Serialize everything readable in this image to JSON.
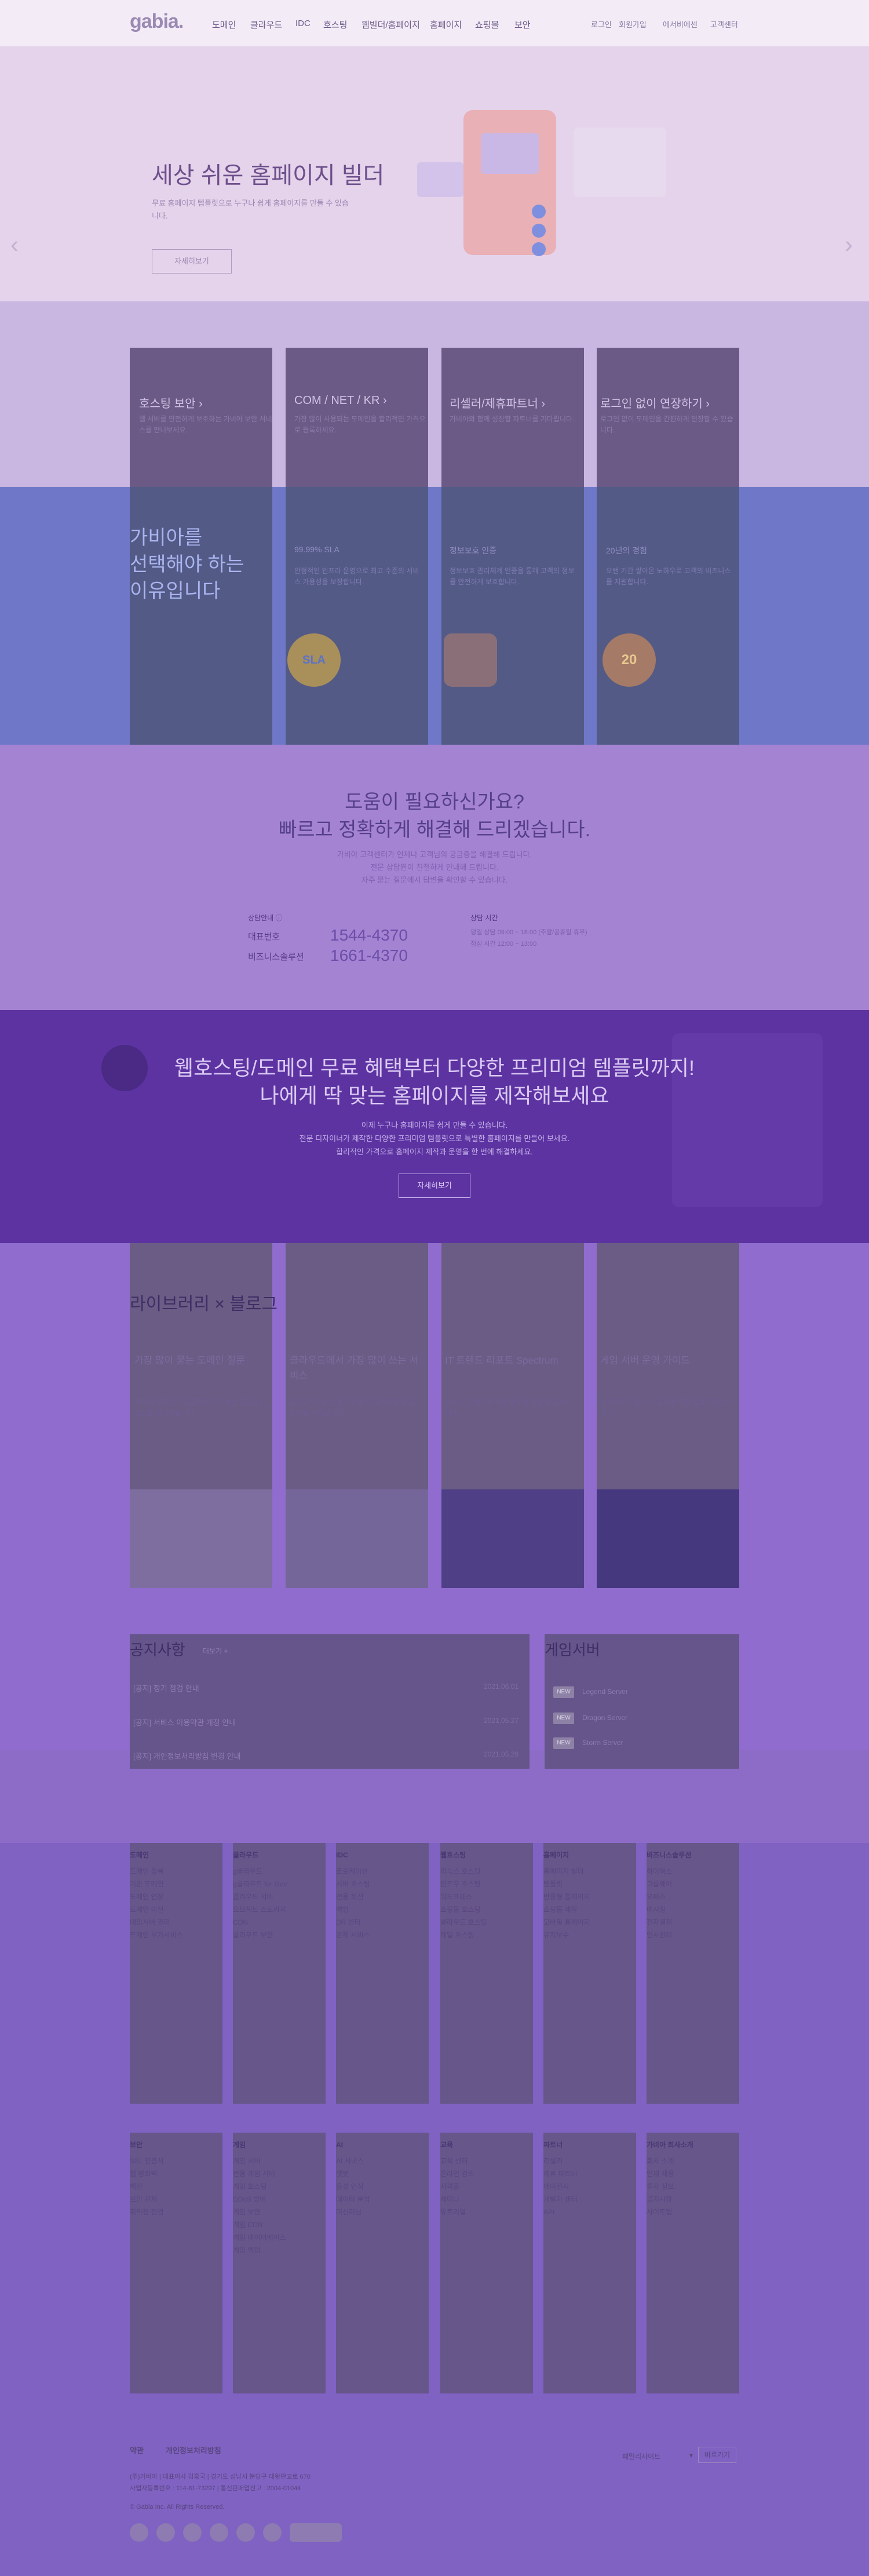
{
  "nav": {
    "logo": "gabia.",
    "items": [
      "도메인",
      "클라우드",
      "IDC",
      "호스팅",
      "웹빌더/홈페이지",
      "홈페이지",
      "쇼핑몰",
      "보안"
    ],
    "util": [
      "로그인",
      "회원가입",
      "에서비에센",
      "고객센터"
    ]
  },
  "hero": {
    "title": "세상 쉬운 홈페이지 빌더",
    "subtitle": "무료 홈페이지 템플릿으로 누구나 쉽게 홈페이지를 만들 수 있습니다.",
    "button": "자세히보기",
    "prev": "‹",
    "next": "›",
    "slide_count": 9,
    "active_slide": 8
  },
  "services": [
    {
      "title": "호스팅 보안 ›",
      "desc": "웹 서버를 안전하게 보호하는 가비아 보안 서비스를 만나보세요."
    },
    {
      "title": "COM / NET / KR ›",
      "desc": "가장 많이 사용되는 도메인을 합리적인 가격으로 등록하세요."
    },
    {
      "title": "리셀러/제휴파트너 ›",
      "desc": "가비아와 함께 성장할 파트너를 기다립니다."
    },
    {
      "title": "로그인 없이 연장하기 ›",
      "desc": "로그인 없이 도메인을 간편하게 연장할 수 있습니다."
    }
  ],
  "why": {
    "title": [
      "가비아를",
      "선택해야 하는",
      "이유입니다"
    ],
    "items": [
      {
        "head": "99.99% SLA",
        "text": "안정적인 인프라 운영으로 최고 수준의 서비스 가용성을 보장합니다."
      },
      {
        "head": "정보보호 인증",
        "text": "정보보호 관리체계 인증을 통해 고객의 정보를 안전하게 보호합니다."
      },
      {
        "head": "20년의 경험",
        "text": "오랜 기간 쌓아온 노하우로 고객의 비즈니스를 지원합니다."
      }
    ],
    "badge_text": [
      "SLA",
      "",
      "20"
    ]
  },
  "help": {
    "title": [
      "도움이 필요하신가요?",
      "빠르고 정확하게 해결해 드리겠습니다."
    ],
    "desc": [
      "가비아 고객센터가 언제나 고객님의 궁금증을 해결해 드립니다.",
      "전문 상담원이 친절하게 안내해 드립니다.",
      "자주 묻는 질문에서 답변을 확인할 수 있습니다."
    ],
    "contact_label": "상담안내 ⓘ",
    "main_label": "대표번호",
    "main_number": "1544-4370",
    "biz_label": "비즈니스솔루션",
    "biz_number": "1661-4370",
    "hours_label": "상담 시간",
    "hours": [
      "평일 상담 09:00 ~ 18:00 (주말/공휴일 휴무)",
      "점심 시간 12:00 ~ 13:00"
    ]
  },
  "promo": {
    "title": [
      "웹호스팅/도메인 무료 혜택부터 다양한 프리미엄 템플릿까지!",
      "나에게 딱 맞는 홈페이지를 제작해보세요"
    ],
    "desc": [
      "이제 누구나 홈페이지를 쉽게 만들 수 있습니다.",
      "전문 디자이너가 제작한 다양한 프리미엄 템플릿으로 특별한 홈페이지를 만들어 보세요.",
      "합리적인 가격으로 홈페이지 제작과 운영을 한 번에 해결하세요."
    ],
    "button": "자세히보기"
  },
  "blog": {
    "title": "라이브러리 × 블로그",
    "posts": [
      {
        "title": "가장 많이 묻는 도메인 질문",
        "desc": "도메인 등록부터 연결까지 자주 묻는 질문과 답변을 정리했습니다."
      },
      {
        "title": "클라우드에서 가장 많이 쓰는 서비스",
        "desc": "클라우드 서비스를 시작할 때 알아두면 좋은 정보를 소개합니다."
      },
      {
        "title": "IT 트렌드 리포트 Spectrum",
        "desc": "최신 IT 트렌드와 기술 동향을 한눈에 살펴보세요."
      },
      {
        "title": "게임 서버 운영 가이드",
        "desc": "안정적인 게임 서버 운영을 위한 팁을 확인하세요."
      }
    ]
  },
  "notice": {
    "title": "공지사항",
    "more": "더보기 +",
    "rows": [
      {
        "text": "[공지] 정기 점검 안내",
        "date": "2021.06.01"
      },
      {
        "text": "[공지] 서비스 이용약관 개정 안내",
        "date": "2021.05.27"
      },
      {
        "text": "[공지] 개인정보처리방침 변경 안내",
        "date": "2021.05.20"
      }
    ]
  },
  "server": {
    "title": "게임서버",
    "rows": [
      {
        "tag": "NEW",
        "text": "Legend Server"
      },
      {
        "tag": "NEW",
        "text": "Dragon Server"
      },
      {
        "tag": "NEW",
        "text": "Storm Server"
      }
    ]
  },
  "footer": {
    "cols_top": [
      {
        "title": "도메인",
        "items": [
          "도메인 등록",
          "기관 도메인",
          "도메인 연장",
          "도메인 이전",
          "네임서버 관리",
          "도메인 부가서비스"
        ]
      },
      {
        "title": "클라우드",
        "items": [
          "g클라우드",
          "g클라우드 for Gov",
          "클라우드 서버",
          "오브젝트 스토리지",
          "CDN",
          "클라우드 보안"
        ]
      },
      {
        "title": "IDC",
        "items": [
          "코로케이션",
          "서버 호스팅",
          "전용 회선",
          "백업",
          "DR 센터",
          "관제 서비스"
        ]
      },
      {
        "title": "웹호스팅",
        "items": [
          "리눅스 호스팅",
          "윈도우 호스팅",
          "워드프레스",
          "쇼핑몰 호스팅",
          "클라우드 호스팅",
          "메일 호스팅"
        ]
      },
      {
        "title": "홈페이지",
        "items": [
          "홈페이지 빌더",
          "템플릿",
          "반응형 홈페이지",
          "쇼핑몰 제작",
          "모바일 홈페이지",
          "유지보수"
        ]
      },
      {
        "title": "비즈니스솔루션",
        "items": [
          "하이웍스",
          "그룹웨어",
          "오피스",
          "메시징",
          "전자결재",
          "인사관리"
        ]
      }
    ],
    "cols_bottom": [
      {
        "title": "보안",
        "items": [
          "SSL 인증서",
          "웹 방화벽",
          "백신",
          "보안 관제",
          "취약점 점검"
        ]
      },
      {
        "title": "게임",
        "items": [
          "게임 서버",
          "전용 게임 서버",
          "게임 호스팅",
          "DDoS 방어",
          "게임 보안",
          "게임 CDN",
          "게임 데이터베이스",
          "게임 백업"
        ]
      },
      {
        "title": "AI",
        "items": [
          "AI 서비스",
          "챗봇",
          "음성 인식",
          "데이터 분석",
          "머신러닝"
        ]
      },
      {
        "title": "교육",
        "items": [
          "교육 센터",
          "온라인 강의",
          "자격증",
          "세미나",
          "튜토리얼"
        ]
      },
      {
        "title": "파트너",
        "items": [
          "리셀러",
          "제휴 파트너",
          "에이전시",
          "개발자 센터",
          "API"
        ]
      },
      {
        "title": "가비아 회사소개",
        "items": [
          "회사 소개",
          "인재 채용",
          "투자 정보",
          "공지사항",
          "사이트맵"
        ]
      }
    ],
    "links": [
      "약관",
      "개인정보처리방침"
    ],
    "family_site": "패밀리사이트",
    "family_btn": "바로가기",
    "info": [
      "(주)가비아 | 대표이사 김홍국 | 경기도 성남시 분당구 대왕판교로 670",
      "사업자등록번호 : 114-81-73297 | 통신판매업신고 : 2004-01044"
    ],
    "copyright": "© Gabia Inc. All Rights Reserved."
  }
}
